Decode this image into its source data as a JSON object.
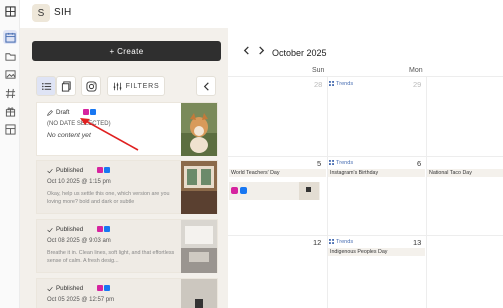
{
  "rail": {
    "items": [
      "table-icon",
      "calendar-icon",
      "folder-icon",
      "image-icon",
      "hashtag-icon",
      "gift-icon",
      "layout-icon"
    ],
    "active": "calendar-icon"
  },
  "workspace": {
    "initial": "S",
    "name": "SIH"
  },
  "panel": {
    "create_label": "+ Create",
    "filters_label": "FILTERS",
    "posts": [
      {
        "status": "Draft",
        "date": "(NO DATE SELECTED)",
        "content": "No content yet",
        "networks": [
          "instagram",
          "facebook"
        ]
      },
      {
        "status": "Published",
        "date": "Oct 10 2025 @ 1:15 pm",
        "content": "Okay, help us settle this one, which version are you loving more? bold and dark or subtle",
        "networks": [
          "instagram",
          "facebook"
        ]
      },
      {
        "status": "Published",
        "date": "Oct 08 2025 @ 9:03 am",
        "content": "Breathe it in. Clean lines, soft light, and that effortless sense of calm. A fresh desig...",
        "networks": [
          "instagram",
          "facebook"
        ]
      },
      {
        "status": "Published",
        "date": "Oct 05 2025 @ 12:57 pm",
        "content": "",
        "networks": [
          "instagram",
          "facebook"
        ]
      }
    ]
  },
  "calendar": {
    "month_label": "October 2025",
    "days": [
      "Sun",
      "Mon"
    ],
    "weeks": [
      {
        "sun": "28",
        "mon": "29",
        "sun_pill": "Trends",
        "mon_pill": "Trends"
      },
      {
        "sun": "5",
        "mon": "6",
        "mon_pill": "Trends",
        "holidays_left": "World Teachers' Day",
        "holidays_mid": "Instagram's Birthday",
        "holidays_right": "National Taco Day"
      },
      {
        "sun": "12",
        "mon": "13",
        "mon_pill": "Trends",
        "holidays_mid": "Indigenous Peoples Day"
      }
    ]
  },
  "colors": {
    "accent": "#4a6fb3",
    "instagram": "#d6249f",
    "facebook": "#1877f2",
    "create_bg": "#2f2f2f"
  }
}
